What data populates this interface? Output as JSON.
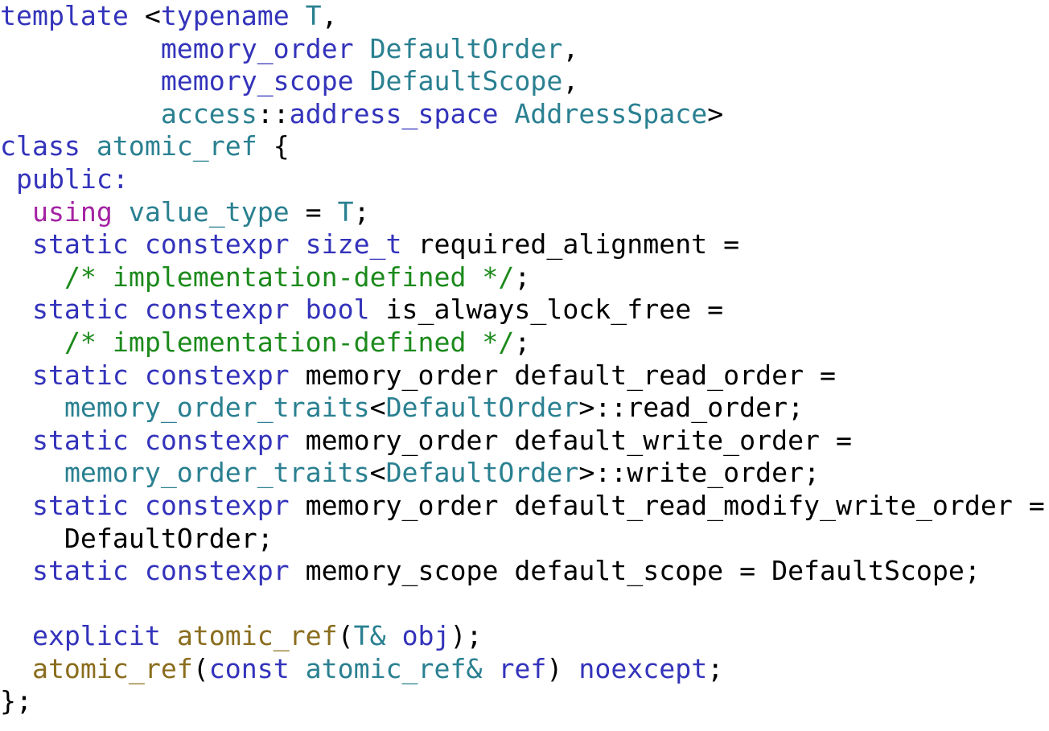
{
  "document": {
    "kind": "source-code-listing",
    "language": "C++",
    "background_color": "#ffffff",
    "colors": {
      "keyword": "#3333bb",
      "type": "#2a8091",
      "using_keyword": "#a322a3",
      "comment": "#1c8a1c",
      "function_name": "#8a6d1e",
      "plain": "#000000"
    }
  },
  "code": {
    "lines": [
      {
        "id": "line-1",
        "text": "template <typename T,",
        "tokens": [
          {
            "t": "template",
            "c": "kw"
          },
          {
            "t": " ",
            "c": "pl"
          },
          {
            "t": "<",
            "c": "pl"
          },
          {
            "t": "typename",
            "c": "kw"
          },
          {
            "t": " ",
            "c": "pl"
          },
          {
            "t": "T",
            "c": "ty"
          },
          {
            "t": ",",
            "c": "pl"
          }
        ]
      },
      {
        "id": "line-2",
        "text": "          memory_order DefaultOrder,",
        "tokens": [
          {
            "t": "          ",
            "c": "pl"
          },
          {
            "t": "memory_order",
            "c": "kw"
          },
          {
            "t": " ",
            "c": "pl"
          },
          {
            "t": "DefaultOrder",
            "c": "ty"
          },
          {
            "t": ",",
            "c": "pl"
          }
        ]
      },
      {
        "id": "line-3",
        "text": "          memory_scope DefaultScope,",
        "tokens": [
          {
            "t": "          ",
            "c": "pl"
          },
          {
            "t": "memory_scope",
            "c": "kw"
          },
          {
            "t": " ",
            "c": "pl"
          },
          {
            "t": "DefaultScope",
            "c": "ty"
          },
          {
            "t": ",",
            "c": "pl"
          }
        ]
      },
      {
        "id": "line-4",
        "text": "          access::address_space AddressSpace>",
        "tokens": [
          {
            "t": "          ",
            "c": "pl"
          },
          {
            "t": "access",
            "c": "ty"
          },
          {
            "t": "::",
            "c": "pl"
          },
          {
            "t": "address_space",
            "c": "kw"
          },
          {
            "t": " ",
            "c": "pl"
          },
          {
            "t": "AddressSpace",
            "c": "ty"
          },
          {
            "t": ">",
            "c": "pl"
          }
        ]
      },
      {
        "id": "line-5",
        "text": "class atomic_ref {",
        "tokens": [
          {
            "t": "class",
            "c": "kw"
          },
          {
            "t": " ",
            "c": "pl"
          },
          {
            "t": "atomic_ref",
            "c": "ty"
          },
          {
            "t": " ",
            "c": "pl"
          },
          {
            "t": "{",
            "c": "pl"
          }
        ]
      },
      {
        "id": "line-6",
        "text": " public:",
        "tokens": [
          {
            "t": " ",
            "c": "pl"
          },
          {
            "t": "public:",
            "c": "kw"
          }
        ]
      },
      {
        "id": "line-7",
        "text": "  using value_type = T;",
        "tokens": [
          {
            "t": "  ",
            "c": "pl"
          },
          {
            "t": "using",
            "c": "us"
          },
          {
            "t": " ",
            "c": "pl"
          },
          {
            "t": "value_type",
            "c": "ty"
          },
          {
            "t": " = ",
            "c": "pl"
          },
          {
            "t": "T",
            "c": "ty"
          },
          {
            "t": ";",
            "c": "pl"
          }
        ]
      },
      {
        "id": "line-8",
        "text": "  static constexpr size_t required_alignment =",
        "tokens": [
          {
            "t": "  ",
            "c": "pl"
          },
          {
            "t": "static constexpr size_t",
            "c": "kw"
          },
          {
            "t": " required_alignment =",
            "c": "pl"
          }
        ]
      },
      {
        "id": "line-9",
        "text": "    /* implementation-defined */;",
        "tokens": [
          {
            "t": "    ",
            "c": "pl"
          },
          {
            "t": "/* implementation-defined */",
            "c": "cm"
          },
          {
            "t": ";",
            "c": "pl"
          }
        ]
      },
      {
        "id": "line-10",
        "text": "  static constexpr bool is_always_lock_free =",
        "tokens": [
          {
            "t": "  ",
            "c": "pl"
          },
          {
            "t": "static constexpr bool",
            "c": "kw"
          },
          {
            "t": " is_always_lock_free =",
            "c": "pl"
          }
        ]
      },
      {
        "id": "line-11",
        "text": "    /* implementation-defined */;",
        "tokens": [
          {
            "t": "    ",
            "c": "pl"
          },
          {
            "t": "/* implementation-defined */",
            "c": "cm"
          },
          {
            "t": ";",
            "c": "pl"
          }
        ]
      },
      {
        "id": "line-12",
        "text": "  static constexpr memory_order default_read_order =",
        "tokens": [
          {
            "t": "  ",
            "c": "pl"
          },
          {
            "t": "static constexpr",
            "c": "kw"
          },
          {
            "t": " memory_order default_read_order =",
            "c": "pl"
          }
        ]
      },
      {
        "id": "line-13",
        "text": "    memory_order_traits<DefaultOrder>::read_order;",
        "tokens": [
          {
            "t": "    ",
            "c": "pl"
          },
          {
            "t": "memory_order_traits",
            "c": "ty"
          },
          {
            "t": "<",
            "c": "pl"
          },
          {
            "t": "DefaultOrder",
            "c": "ty"
          },
          {
            "t": ">::read_order;",
            "c": "pl"
          }
        ]
      },
      {
        "id": "line-14",
        "text": "  static constexpr memory_order default_write_order =",
        "tokens": [
          {
            "t": "  ",
            "c": "pl"
          },
          {
            "t": "static constexpr",
            "c": "kw"
          },
          {
            "t": " memory_order default_write_order =",
            "c": "pl"
          }
        ]
      },
      {
        "id": "line-15",
        "text": "    memory_order_traits<DefaultOrder>::write_order;",
        "tokens": [
          {
            "t": "    ",
            "c": "pl"
          },
          {
            "t": "memory_order_traits",
            "c": "ty"
          },
          {
            "t": "<",
            "c": "pl"
          },
          {
            "t": "DefaultOrder",
            "c": "ty"
          },
          {
            "t": ">::write_order;",
            "c": "pl"
          }
        ]
      },
      {
        "id": "line-16",
        "text": "  static constexpr memory_order default_read_modify_write_order =",
        "tokens": [
          {
            "t": "  ",
            "c": "pl"
          },
          {
            "t": "static constexpr",
            "c": "kw"
          },
          {
            "t": " memory_order default_read_modify_write_order =",
            "c": "pl"
          }
        ]
      },
      {
        "id": "line-17",
        "text": "    DefaultOrder;",
        "tokens": [
          {
            "t": "    DefaultOrder;",
            "c": "pl"
          }
        ]
      },
      {
        "id": "line-18",
        "text": "  static constexpr memory_scope default_scope = DefaultScope;",
        "tokens": [
          {
            "t": "  ",
            "c": "pl"
          },
          {
            "t": "static constexpr",
            "c": "kw"
          },
          {
            "t": " memory_scope default_scope = DefaultScope;",
            "c": "pl"
          }
        ]
      },
      {
        "id": "line-19",
        "text": "",
        "tokens": []
      },
      {
        "id": "line-20",
        "text": "  explicit atomic_ref(T& obj);",
        "tokens": [
          {
            "t": "  ",
            "c": "pl"
          },
          {
            "t": "explicit",
            "c": "kw"
          },
          {
            "t": " ",
            "c": "pl"
          },
          {
            "t": "atomic_ref",
            "c": "fn"
          },
          {
            "t": "(",
            "c": "pl"
          },
          {
            "t": "T&",
            "c": "ty"
          },
          {
            "t": " ",
            "c": "pl"
          },
          {
            "t": "obj",
            "c": "var"
          },
          {
            "t": ");",
            "c": "pl"
          }
        ]
      },
      {
        "id": "line-21",
        "text": "  atomic_ref(const atomic_ref& ref) noexcept;",
        "tokens": [
          {
            "t": "  ",
            "c": "pl"
          },
          {
            "t": "atomic_ref",
            "c": "fn"
          },
          {
            "t": "(",
            "c": "pl"
          },
          {
            "t": "const",
            "c": "kw"
          },
          {
            "t": " ",
            "c": "pl"
          },
          {
            "t": "atomic_ref&",
            "c": "ty"
          },
          {
            "t": " ",
            "c": "pl"
          },
          {
            "t": "ref",
            "c": "var"
          },
          {
            "t": ") ",
            "c": "pl"
          },
          {
            "t": "noexcept",
            "c": "kw"
          },
          {
            "t": ";",
            "c": "pl"
          }
        ]
      },
      {
        "id": "line-22",
        "text": "};",
        "tokens": [
          {
            "t": "};",
            "c": "pl"
          }
        ]
      }
    ]
  }
}
